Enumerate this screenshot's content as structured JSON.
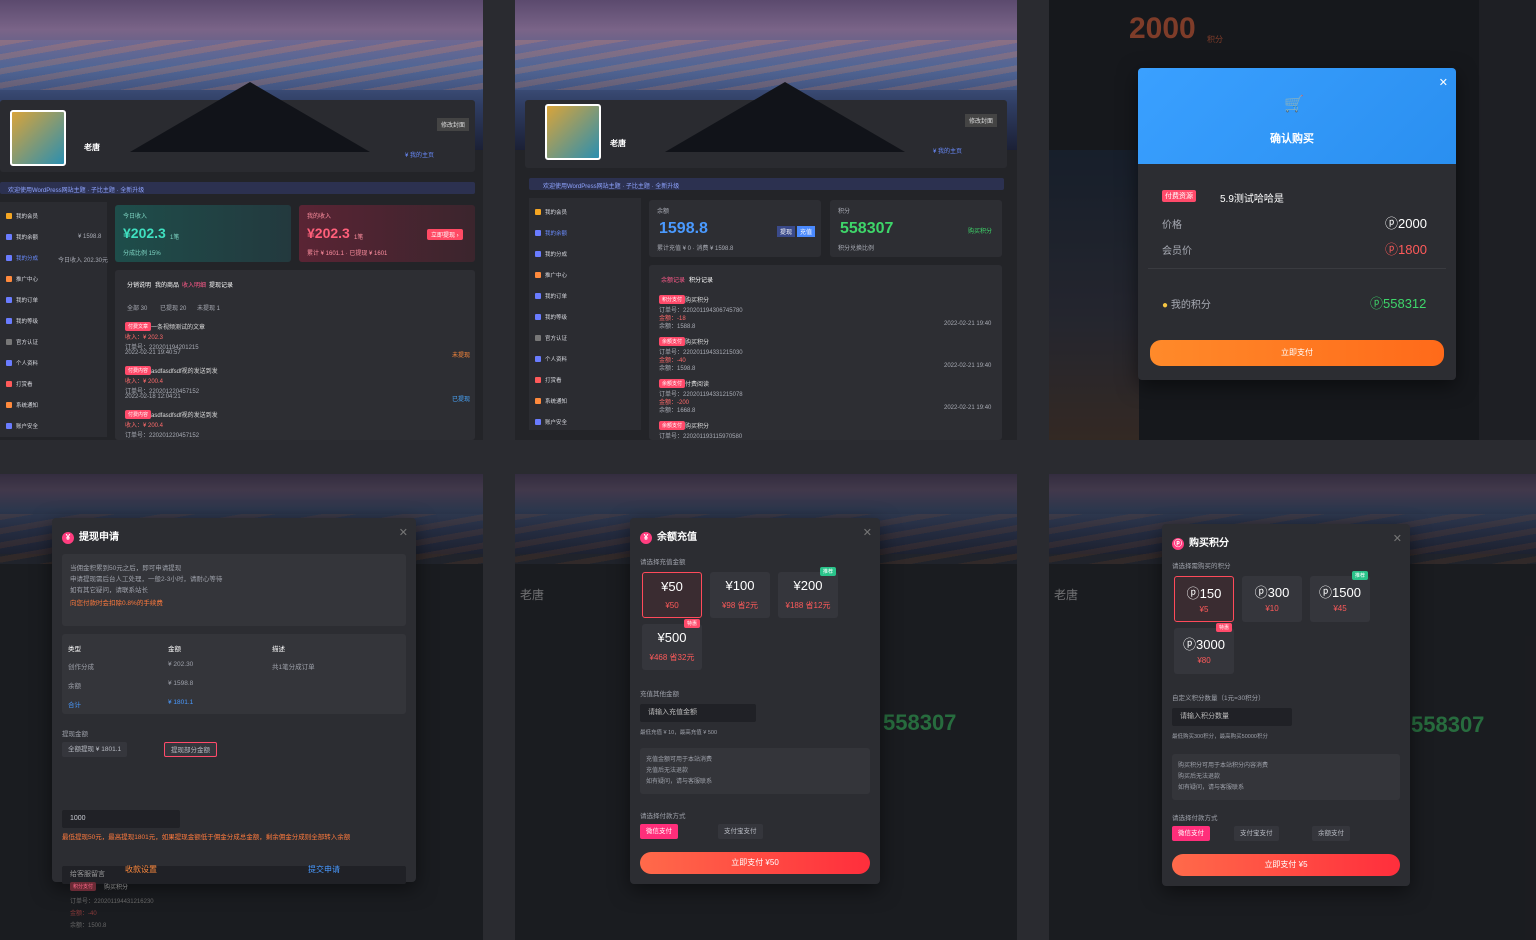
{
  "panel1": {
    "name": "老唐",
    "cover_btn": "修改封面",
    "follow": "¥ 我的主页",
    "nav": "欢迎使用WordPress网站主题 · 子比主题 · 全新升级",
    "menu": [
      "我的会员",
      "我的余额",
      "我的分成",
      "推广中心",
      "我的订单",
      "我的等级",
      "官方认证",
      "个人资料",
      "打赏看",
      "系统通知",
      "账户安全"
    ],
    "menu_vals": [
      "",
      "¥ 1598.8",
      "今日收入 202.30元",
      "",
      "",
      "",
      ""
    ],
    "stat1": {
      "label": "今日收入",
      "value": "¥202.3",
      "unit": "1笔",
      "sub": "分成比例 15%"
    },
    "stat2": {
      "label": "我的收入",
      "value": "¥202.3",
      "unit": "1笔",
      "sub": "累计 ¥ 1601.1 · 已提现 ¥ 1601",
      "btn": "立即提现 ›"
    },
    "tabs": [
      "分销说明",
      "我的商品",
      "收入明细",
      "提现记录"
    ],
    "subtabs": [
      "全部 30",
      "已提现 20",
      "未提现 1"
    ],
    "records": [
      {
        "title": "一条视频测试的文章",
        "tag": "付费文章",
        "income": "收入：¥ 202.3",
        "meta": "订单号：220201194201215",
        "date": "2022-02-21 19:40:57",
        "st": "未提现"
      },
      {
        "title": "asdfasdfsdf视的发送到发",
        "tag": "付费内容",
        "income": "收入：¥ 200.4",
        "meta": "订单号：220201220457152",
        "date": "2022-02-18 12:04:21",
        "st": "已提现"
      },
      {
        "title": "asdfasdfsdf视的发送到发",
        "tag": "付费内容",
        "income": "收入：¥ 200.4",
        "meta": "订单号：220201220457152",
        "date": ""
      }
    ]
  },
  "panel2": {
    "balance_label": "余额",
    "balance": "1598.8",
    "balance_sub": "累计充值 ¥ 0 · 消费 ¥ 1598.8",
    "btn_a": "提现",
    "btn_b": "充值",
    "points_label": "积分",
    "points": "558307",
    "points_sub": "积分兑换比例",
    "points_btn": "购买积分",
    "tabs": [
      "余额记录",
      "积分记录"
    ],
    "records": [
      {
        "tag": "积分支付",
        "title": "购买积分",
        "l1": "订单号：220201194306745780",
        "l2": "金额：-18",
        "l3": "余额：1588.8",
        "date": "2022-02-21 19:40"
      },
      {
        "tag": "余额支付",
        "title": "购买积分",
        "l1": "订单号：220201194331215030",
        "l2": "金额：-40",
        "l3": "余额：1598.8",
        "date": "2022-02-21 19:40"
      },
      {
        "tag": "余额支付",
        "title": "付费阅读",
        "l1": "订单号：220201194331215078",
        "l2": "金额：-200",
        "l3": "余额：1668.8",
        "date": "2022-02-21 19:40"
      },
      {
        "tag": "余额支付",
        "title": "购买积分",
        "l1": "订单号：220201193115970580",
        "l2": "",
        "l3": "",
        "date": ""
      }
    ]
  },
  "panel3": {
    "points_top": "2000",
    "points_top_unit": "积分",
    "title": "确认购买",
    "tag": "付费资源",
    "product": "5.9测试哈哈是",
    "price_label": "价格",
    "price": "2000",
    "vip_label": "会员价",
    "vip_price": "1800",
    "my_label": "我的积分",
    "my_points": "558312",
    "btn": "立即支付"
  },
  "panel4": {
    "title": "提现申请",
    "notes": [
      "当佣金积累到50元之后，即可申请提现",
      "申请提现需后台人工处理，一般2-3小时，请耐心等待",
      "如有其它疑问，请联系站长"
    ],
    "warn": "向您付款时会扣除0.8%的手续费",
    "th": [
      "类型",
      "金额",
      "描述"
    ],
    "rows": [
      [
        "创作分成",
        "¥ 202.30",
        "共1笔分成订单"
      ],
      [
        "余额",
        "¥ 1598.8",
        ""
      ],
      [
        "合计",
        "¥ 1801.1",
        ""
      ]
    ],
    "amount_label": "提现金额",
    "radio1": "全额提现 ¥ 1801.1",
    "radio2": "提现部分金额",
    "amount": "1000",
    "amount_warn": "最低提现50元，最高提现1801元，如果提现金额低于佣金分成总金额，剩余佣金分成则全部转入余额",
    "msg_ph": "给客服留言",
    "btn_set": "收款设置",
    "btn_submit": "提交申请",
    "bottom_tag": "积分支付",
    "bottom_title": "购买积分",
    "bottom_l1": "订单号：220201194431216230",
    "bottom_l2": "金额：-40",
    "bottom_l3": "余额：1500.8"
  },
  "panel5": {
    "title": "余额充值",
    "choose": "请选择充值金额",
    "options": [
      {
        "a": "¥50",
        "b": "¥50",
        "tag": ""
      },
      {
        "a": "¥100",
        "b": "¥98 省2元",
        "tag": ""
      },
      {
        "a": "¥200",
        "b": "¥188 省12元",
        "tag": "推荐"
      },
      {
        "a": "¥500",
        "b": "¥468 省32元",
        "tag": "特惠"
      }
    ],
    "other": "充值其他金额",
    "ph": "请输入充值金额",
    "range": "最低充值 ¥ 10，最高充值 ¥ 500",
    "notes": [
      "充值金额可用于本站消费",
      "充值后无法退款",
      "如有疑问，请与客服联系"
    ],
    "pay_label": "请选择付款方式",
    "pay1": "微信支付",
    "pay2": "支付宝支付",
    "btn": "立即支付 ¥50",
    "bg_name": "老唐",
    "bg_num": "558307"
  },
  "panel6": {
    "title": "购买积分",
    "choose": "请选择需购买的积分",
    "options": [
      {
        "a": "150",
        "b": "¥5",
        "tag": ""
      },
      {
        "a": "300",
        "b": "¥10",
        "tag": ""
      },
      {
        "a": "1500",
        "b": "¥45",
        "tag": "推荐"
      },
      {
        "a": "3000",
        "b": "¥80",
        "tag": "特惠"
      }
    ],
    "custom": "自定义积分数量（1元=30积分）",
    "ph": "请输入积分数量",
    "range": "最低购买300积分，最高购买50000积分",
    "notes": [
      "购买积分可用于本站积分内容消费",
      "购买后无法退款",
      "如有疑问，请与客服联系"
    ],
    "pay_label": "请选择付款方式",
    "pay1": "微信支付",
    "pay2": "支付宝支付",
    "pay3": "余额支付",
    "btn": "立即支付 ¥5",
    "bg_name": "老唐",
    "bg_num": "558307"
  }
}
